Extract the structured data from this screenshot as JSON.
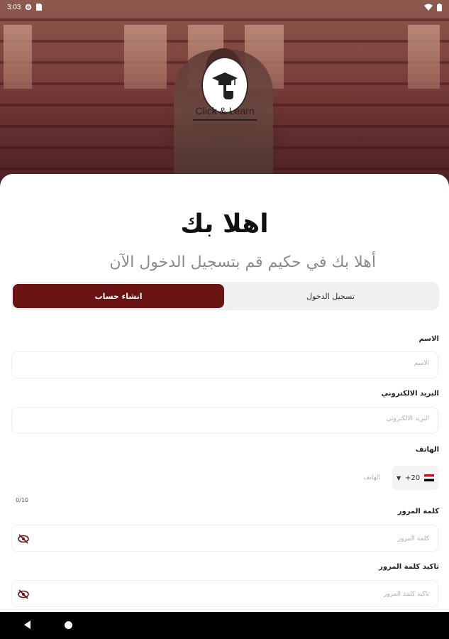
{
  "status_bar": {
    "time": "3:03"
  },
  "logo": {
    "text": "Click & Learn"
  },
  "welcome": {
    "title": "اهلا بك",
    "subtitle": "أهلا بك في حكيم قم بتسجيل الدخول الآن"
  },
  "tabs": {
    "login": "تسجيل الدخول",
    "register": "انشاء حساب",
    "active": "register"
  },
  "form": {
    "name": {
      "label": "الاسم",
      "placeholder": "الاسم"
    },
    "email": {
      "label": "البريد الالكتروني",
      "placeholder": "البريد الالكتروني"
    },
    "phone": {
      "label": "الهاتف",
      "placeholder": "الهاتف",
      "country_code": "+20",
      "counter": "0/10"
    },
    "password": {
      "label": "كلمة المرور",
      "placeholder": "كلمة المرور"
    },
    "confirm_password": {
      "label": "تاكيد كلمة المرور",
      "placeholder": "تاكيد كلمة المرور"
    }
  },
  "colors": {
    "primary": "#6b1414",
    "muted_text": "#8a8a8a"
  },
  "icons": [
    "wifi-icon",
    "battery-icon",
    "settings-icon",
    "sim-icon",
    "eye-off-icon",
    "back-icon",
    "home-icon",
    "graduation-cap-icon",
    "hand-cursor-icon"
  ]
}
